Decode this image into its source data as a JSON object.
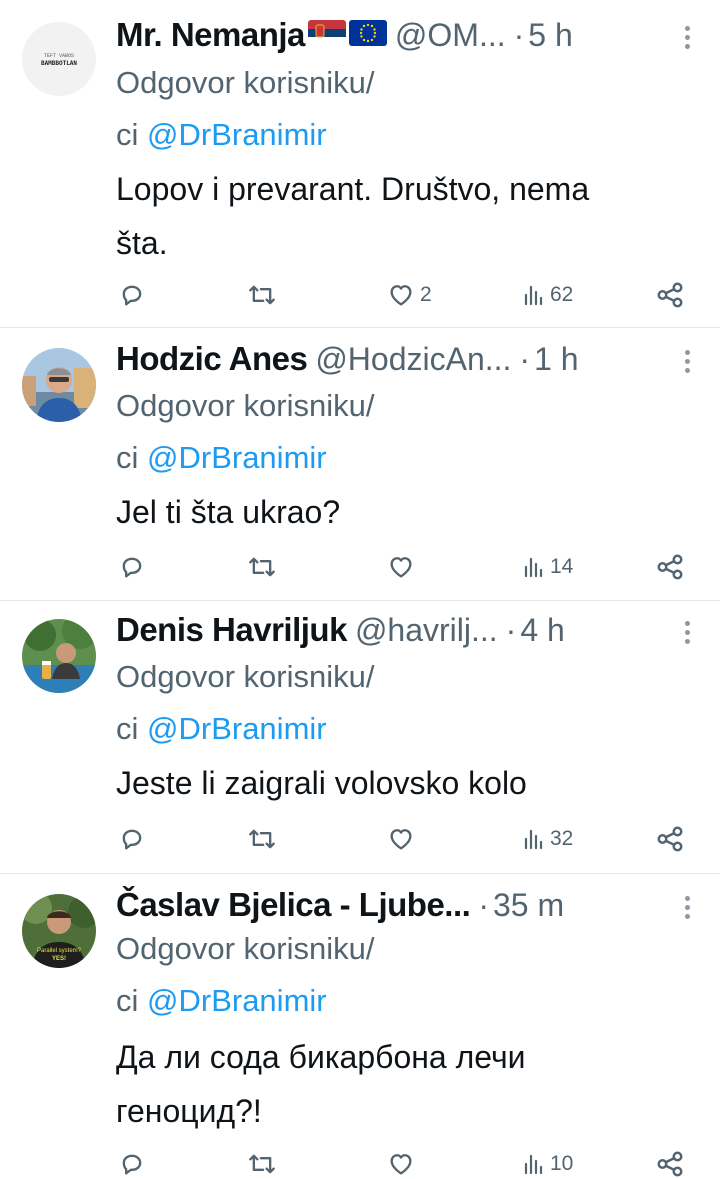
{
  "reply_prefix": "Odgovor korisniku/",
  "reply_suffix_start": "ci",
  "tweets": [
    {
      "name": "Mr. Nemanja",
      "handle": "@OM...",
      "dot": "·",
      "time": "5 h",
      "mention": "@DrBranimir",
      "text_line1": "Lopov i prevarant. Društvo, nema",
      "text_line2": "šta.",
      "likes": "2",
      "views": "62"
    },
    {
      "name": "Hodzic Anes",
      "handle": "@HodzicAn...",
      "dot": "·",
      "time": "1 h",
      "mention": "@DrBranimir",
      "text_line1": "Jel ti šta ukrao?",
      "text_line2": "",
      "likes": "",
      "views": "14"
    },
    {
      "name": "Denis Havriljuk",
      "handle": "@havrilj...",
      "dot": "·",
      "time": "4 h",
      "mention": "@DrBranimir",
      "text_line1": "Jeste li zaigrali volovsko kolo",
      "text_line2": "",
      "likes": "",
      "views": "32"
    },
    {
      "name": "Časlav Bjelica - Ljube...",
      "handle": "",
      "dot": "·",
      "time": "35 m",
      "mention": "@DrBranimir",
      "text_line1": "Да ли сода бикарбона лечи",
      "text_line2": "геноцид?!",
      "likes": "",
      "views": "10"
    }
  ],
  "avatar_texts": {
    "t0_line1": "TEFT VABOS",
    "t0_line2": "BAMBBOTLAN",
    "t3_line1": "Parallel system?",
    "t3_line2": "YES!"
  },
  "icons": {
    "reply": "reply-icon",
    "retweet": "retweet-icon",
    "like": "heart-icon",
    "views": "views-icon",
    "share": "share-icon",
    "more": "more-icon"
  },
  "colors": {
    "mention": "#1d9bf0",
    "secondary": "#536471",
    "text": "#0f1419"
  }
}
